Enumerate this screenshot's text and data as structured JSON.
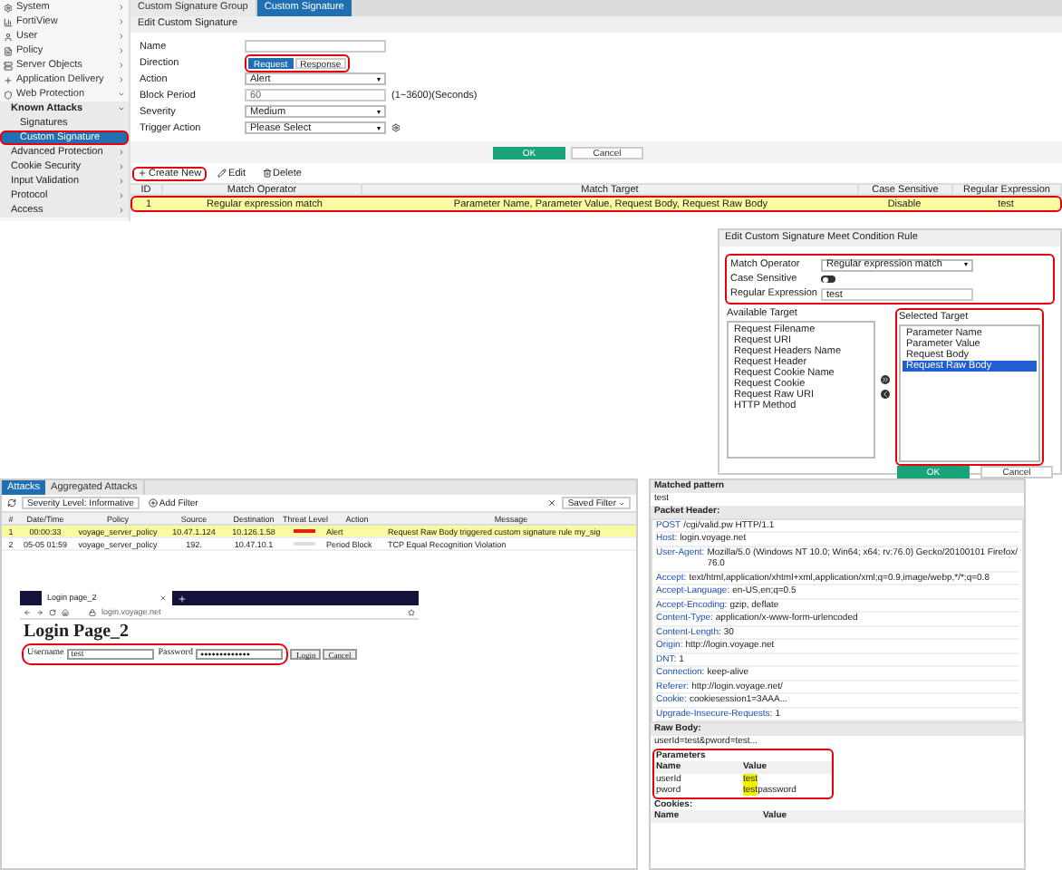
{
  "sidebar": {
    "items": [
      {
        "label": "System",
        "expanded": false,
        "selected": false
      },
      {
        "label": "FortiView",
        "expanded": false,
        "selected": false
      },
      {
        "label": "User",
        "expanded": false,
        "selected": false
      },
      {
        "label": "Policy",
        "expanded": false,
        "selected": false
      },
      {
        "label": "Server Objects",
        "expanded": false,
        "selected": false
      },
      {
        "label": "Application Delivery",
        "expanded": false,
        "selected": false
      },
      {
        "label": "Web Protection",
        "expanded": true,
        "selected": false,
        "children": [
          {
            "label": "Known Attacks",
            "expanded": true,
            "selected": false,
            "children": [
              {
                "label": "Signatures",
                "selected": false,
                "marked": false
              },
              {
                "label": "Custom Signature",
                "selected": true,
                "marked": true
              }
            ]
          },
          {
            "label": "Advanced Protection",
            "expanded": false,
            "selected": false
          },
          {
            "label": "Cookie Security",
            "expanded": false,
            "selected": false
          },
          {
            "label": "Input Validation",
            "expanded": false,
            "selected": false
          },
          {
            "label": "Protocol",
            "expanded": false,
            "selected": false
          },
          {
            "label": "Access",
            "expanded": false,
            "selected": false
          }
        ]
      }
    ]
  },
  "tabs": [
    {
      "label": "Custom Signature Group",
      "selected": false
    },
    {
      "label": "Custom Signature",
      "selected": true
    }
  ],
  "form": {
    "title": "Edit Custom Signature",
    "name": {
      "label": "Name"
    },
    "direction": {
      "label": "Direction",
      "marked": true,
      "options": [
        {
          "label": "Request",
          "selected": true
        },
        {
          "label": "Response",
          "selected": false
        }
      ]
    },
    "action": {
      "label": "Action",
      "value": "Alert"
    },
    "block_period": {
      "label": "Block Period",
      "value": "60",
      "hint": "(1~3600)(Seconds)"
    },
    "severity": {
      "label": "Severity",
      "value": "Medium"
    },
    "trigger_action": {
      "label": "Trigger Action",
      "value": "Please Select"
    },
    "buttons": [
      "OK",
      "Cancel"
    ]
  },
  "toolbar": [
    {
      "label": "Create New",
      "marked": true
    },
    {
      "label": "Edit",
      "marked": false
    },
    {
      "label": "Delete",
      "marked": false
    }
  ],
  "rules_table": {
    "columns": [
      "ID",
      "Match Operator",
      "Match Target",
      "Case Sensitive",
      "Regular Expression"
    ],
    "rows": [
      {
        "marked": true,
        "selected": true,
        "cells": [
          "1",
          "Regular expression match",
          "Parameter Name, Parameter Value, Request Body, Request Raw Body",
          "Disable",
          "test"
        ]
      }
    ]
  },
  "condition_dialog": {
    "title": "Edit Custom Signature Meet Condition Rule",
    "match_operator": {
      "label": "Match Operator",
      "value": "Regular expression match"
    },
    "case_sensitive": {
      "label": "Case Sensitive",
      "on": false
    },
    "regular_expression": {
      "label": "Regular Expression",
      "value": "test"
    },
    "available_target": {
      "label": "Available Target",
      "items": [
        {
          "label": "Request Filename",
          "selected": false
        },
        {
          "label": "Request URI",
          "selected": false
        },
        {
          "label": "Request Headers Name",
          "selected": false
        },
        {
          "label": "Request Header",
          "selected": false
        },
        {
          "label": "Request Cookie Name",
          "selected": false
        },
        {
          "label": "Request Cookie",
          "selected": false
        },
        {
          "label": "Request Raw URI",
          "selected": false
        },
        {
          "label": "HTTP Method",
          "selected": false
        }
      ]
    },
    "selected_target": {
      "label": "Selected Target",
      "items": [
        {
          "label": "Parameter Name",
          "selected": false
        },
        {
          "label": "Parameter Value",
          "selected": false
        },
        {
          "label": "Request Body",
          "selected": false
        },
        {
          "label": "Request Raw Body",
          "selected": true
        }
      ]
    },
    "buttons": [
      "OK",
      "Cancel"
    ]
  },
  "attack_log": {
    "tabs": [
      {
        "label": "Attacks",
        "selected": true
      },
      {
        "label": "Aggregated Attacks",
        "selected": false
      }
    ],
    "severity_filter": "Severity Level: Informative",
    "add_filter": "Add Filter",
    "saved_filter": "Saved Filter",
    "columns": [
      "#",
      "Date/Time",
      "Policy",
      "Source",
      "Destination",
      "Threat Level",
      "Action",
      "Message"
    ],
    "rows": [
      {
        "selected": true,
        "color": "#e02020",
        "cells": [
          "1",
          "00:00:33",
          "voyage_server_policy",
          "10.47.1.124",
          "10.126.1.58",
          "Alert",
          "Request Raw Body triggered custom signature rule my_sig"
        ]
      },
      {
        "selected": false,
        "color": "#dddddd",
        "cells": [
          "2",
          "05-05 01:59",
          "voyage_server_policy",
          "192.",
          "10.47.10.1",
          "Period Block",
          "TCP Equal Recognition Violation"
        ]
      }
    ]
  },
  "login_screenshot": {
    "tab": "Login page_2",
    "url": "login.voyage.net",
    "heading": "Login Page_2",
    "username": {
      "label": "Username",
      "value": "test"
    },
    "password": {
      "label": "Password",
      "value": "●●●●●●●●●●●●●"
    },
    "buttons": [
      "Login",
      "Cancel"
    ]
  },
  "details": {
    "matched_pattern": {
      "label": "Matched pattern",
      "value": "test"
    },
    "packet_header": {
      "label": "Packet Header:",
      "lines": [
        {
          "name": "POST",
          "value": "/cgi/valid.pw HTTP/1.1"
        },
        {
          "name": "Host:",
          "value": "login.voyage.net"
        },
        {
          "name": "User-Agent:",
          "value": "Mozilla/5.0 (Windows NT 10.0; Win64; x64; rv:76.0) Gecko/20100101 Firefox/76.0"
        },
        {
          "name": "Accept:",
          "value": "text/html,application/xhtml+xml,application/xml;q=0.9,image/webp,*/*;q=0.8"
        },
        {
          "name": "Accept-Language:",
          "value": "en-US,en;q=0.5"
        },
        {
          "name": "Accept-Encoding:",
          "value": "gzip, deflate"
        },
        {
          "name": "Content-Type:",
          "value": "application/x-www-form-urlencoded"
        },
        {
          "name": "Content-Length:",
          "value": "30"
        },
        {
          "name": "Origin:",
          "value": "http://login.voyage.net"
        },
        {
          "name": "DNT:",
          "value": "1"
        },
        {
          "name": "Connection:",
          "value": "keep-alive"
        },
        {
          "name": "Referer:",
          "value": "http://login.voyage.net/"
        },
        {
          "name": "Cookie:",
          "value": "cookiesession1=3AAA..."
        },
        {
          "name": "Upgrade-Insecure-Requests:",
          "value": "1"
        }
      ]
    },
    "raw_body": {
      "label": "Raw Body:",
      "value": "userId=test&pword=test..."
    },
    "parameters": {
      "label": "Parameters",
      "columns": [
        "Name",
        "Value"
      ],
      "rows": [
        {
          "name": "userId",
          "match": "test",
          "rest": ""
        },
        {
          "name": "pword",
          "match": "test",
          "rest": "password"
        }
      ]
    },
    "cookies": {
      "label": "Cookies:",
      "columns": [
        "Name",
        "Value"
      ]
    }
  }
}
